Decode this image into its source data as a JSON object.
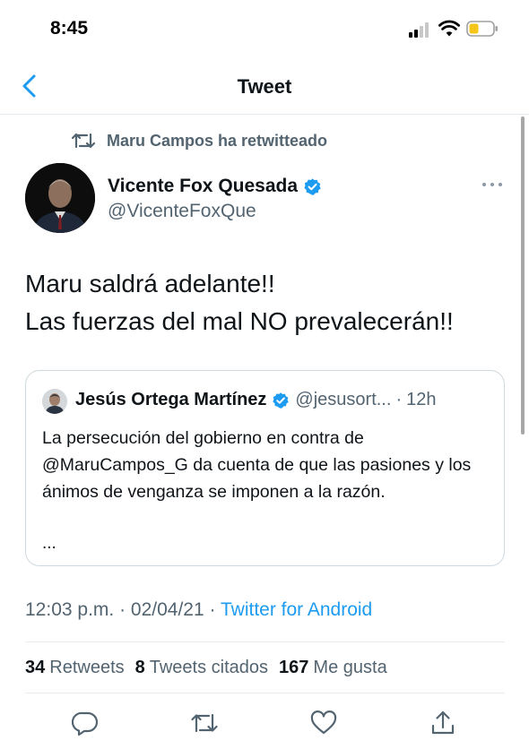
{
  "status_bar": {
    "time": "8:45"
  },
  "nav": {
    "title": "Tweet"
  },
  "retweet": {
    "text": "Maru Campos ha retwitteado"
  },
  "tweet": {
    "author_name": "Vicente Fox Quesada",
    "author_handle": "@VicenteFoxQue",
    "text_line1": "Maru saldrá adelante!!",
    "text_line2": "Las fuerzas del mal NO prevalecerán!!"
  },
  "quote": {
    "author_name": "Jesús Ortega Martínez",
    "author_handle": "@jesusort...",
    "separator": "·",
    "time": "12h",
    "text": "La persecución del gobierno en contra de @MaruCampos_G da cuenta de que las pasiones y los ánimos de venganza se imponen a la razón.",
    "ellipsis": "..."
  },
  "meta": {
    "time": "12:03 p.m.",
    "sep1": "·",
    "date": "02/04/21",
    "sep2": "·",
    "source": "Twitter for Android"
  },
  "stats": {
    "retweets_count": "34",
    "retweets_label": "Retweets",
    "quotes_count": "8",
    "quotes_label": "Tweets citados",
    "likes_count": "167",
    "likes_label": "Me gusta"
  },
  "icons": {
    "back": "chevron-left-icon",
    "retweet": "retweet-icon",
    "verified": "verified-badge-icon",
    "more": "more-horizontal-icon",
    "reply": "reply-icon",
    "like": "heart-icon",
    "share": "share-icon"
  },
  "colors": {
    "accent": "#1d9bf0",
    "secondary_text": "#536471",
    "primary_text": "#0f1419",
    "border": "#cfd9de"
  }
}
